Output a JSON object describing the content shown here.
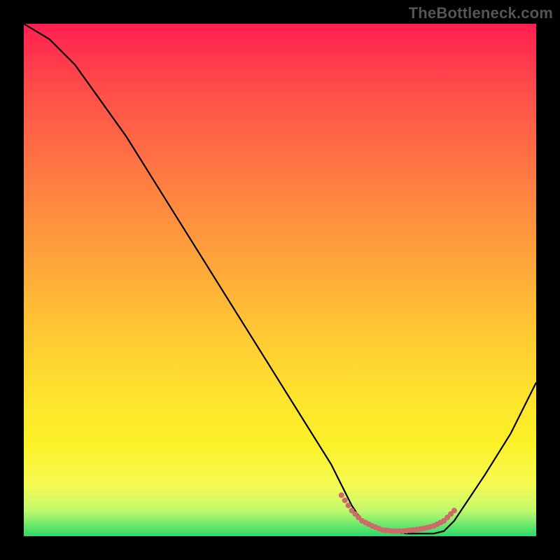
{
  "watermark": "TheBottleneck.com",
  "chart_data": {
    "type": "line",
    "title": "",
    "xlabel": "",
    "ylabel": "",
    "xlim": [
      0,
      100
    ],
    "ylim": [
      0,
      100
    ],
    "grid": false,
    "legend": false,
    "series": [
      {
        "name": "curve",
        "color": "#000000",
        "x": [
          0,
          5,
          10,
          15,
          20,
          25,
          30,
          35,
          40,
          45,
          50,
          55,
          60,
          62,
          64,
          66,
          70,
          75,
          80,
          82,
          84,
          86,
          90,
          95,
          100
        ],
        "y": [
          100,
          97,
          92,
          85,
          78,
          70,
          62,
          54,
          46,
          38,
          30,
          22,
          14,
          10,
          6,
          3,
          1,
          0.5,
          0.5,
          1,
          3,
          6,
          12,
          20,
          30
        ]
      },
      {
        "name": "dotted-segment",
        "color": "#d66",
        "style": "dotted",
        "x": [
          62,
          64,
          66,
          68,
          70,
          72,
          74,
          76,
          78,
          80,
          82,
          84
        ],
        "y": [
          8,
          5,
          3,
          2,
          1.2,
          1,
          1,
          1.2,
          1.5,
          2,
          3,
          5
        ]
      }
    ]
  }
}
